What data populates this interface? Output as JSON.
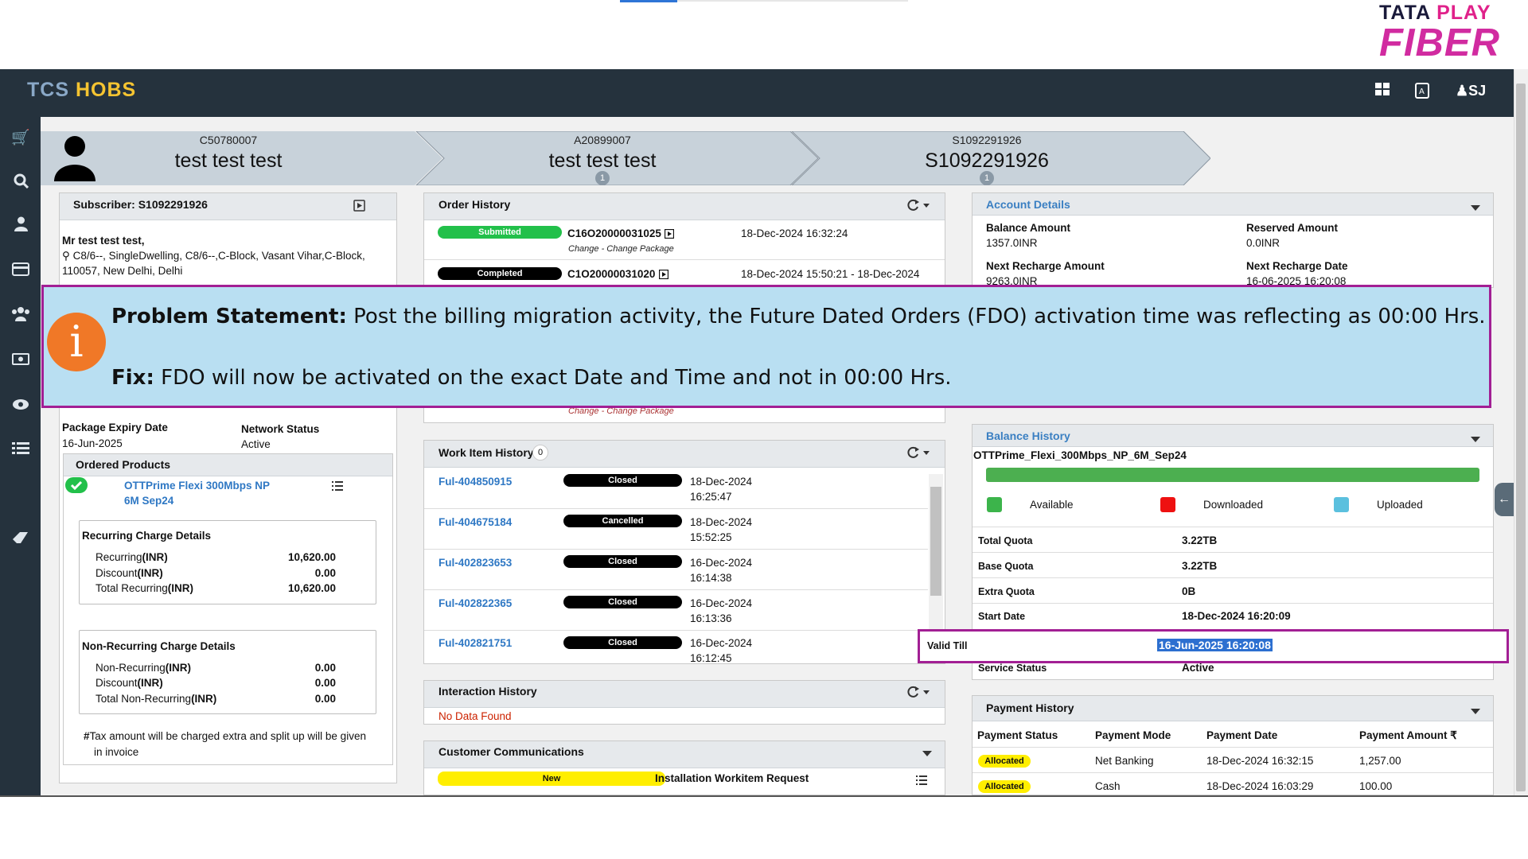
{
  "brand_logo": {
    "line1_a": "TATA",
    "line1_b": "PLAY",
    "line2": "FIBER"
  },
  "app": {
    "name_a": "TCS",
    "name_b": "HOBS",
    "user": "SJ"
  },
  "breadcrumb": [
    {
      "id": "C50780007",
      "name": "test test test",
      "badge": ""
    },
    {
      "id": "A20899007",
      "name": "test test test",
      "badge": "1"
    },
    {
      "id": "S1092291926",
      "name": "S1092291926",
      "badge": "1"
    }
  ],
  "subscriber": {
    "title": "Subscriber: S1092291926",
    "name": "Mr test test test",
    "address_line1": "C8/6--, SingleDwelling, C8/6--,C-Block, Vasant Vihar,C-Block,",
    "address_line2": "110057, New Delhi, Delhi",
    "package_expiry_label": "Package Expiry Date",
    "package_expiry_value": "16-Jun-2025",
    "network_status_label": "Network Status",
    "network_status_value": "Active",
    "ordered_products_label": "Ordered Products",
    "product_name_line1": "OTTPrime Flexi 300Mbps NP",
    "product_name_line2": "6M Sep24",
    "recurring": {
      "title": "Recurring Charge Details",
      "rows": [
        {
          "label": "Recurring",
          "unit": "(INR)",
          "value": "10,620.00"
        },
        {
          "label": "Discount",
          "unit": "(INR)",
          "value": "0.00"
        },
        {
          "label": "Total Recurring",
          "unit": "(INR)",
          "value": "10,620.00"
        }
      ]
    },
    "non_recurring": {
      "title": "Non-Recurring Charge Details",
      "rows": [
        {
          "label": "Non-Recurring",
          "unit": "(INR)",
          "value": "0.00"
        },
        {
          "label": "Discount",
          "unit": "(INR)",
          "value": "0.00"
        },
        {
          "label": "Total Non-Recurring",
          "unit": "(INR)",
          "value": "0.00"
        }
      ]
    },
    "tax_note_line1": "Tax amount will be charged extra and split up will be given",
    "tax_note_line2": "in invoice"
  },
  "order_history": {
    "title": "Order History",
    "orders": [
      {
        "status": "Submitted",
        "id": "C16O20000031025",
        "date": "18-Dec-2024 16:32:24",
        "type": "Change - Change Package"
      },
      {
        "status": "Completed",
        "id": "C1O20000031020",
        "date": "18-Dec-2024 15:50:21 - 18-Dec-2024",
        "type": ""
      }
    ],
    "partial_type": "Change - Change Package"
  },
  "work_items": {
    "title": "Work Item History",
    "count": "0",
    "rows": [
      {
        "id": "Ful-404850915",
        "status": "Closed",
        "date": "18-Dec-2024",
        "time": "16:25:47"
      },
      {
        "id": "Ful-404675184",
        "status": "Cancelled",
        "date": "18-Dec-2024",
        "time": "15:52:25"
      },
      {
        "id": "Ful-402823653",
        "status": "Closed",
        "date": "16-Dec-2024",
        "time": "16:14:38"
      },
      {
        "id": "Ful-402822365",
        "status": "Closed",
        "date": "16-Dec-2024",
        "time": "16:13:36"
      },
      {
        "id": "Ful-402821751",
        "status": "Closed",
        "date": "16-Dec-2024",
        "time": "16:12:45"
      }
    ]
  },
  "interaction_history": {
    "title": "Interaction History",
    "empty": "No Data Found"
  },
  "customer_comms": {
    "title": "Customer Communications",
    "status": "New",
    "text": "Installation Workitem Request"
  },
  "account_details": {
    "title": "Account Details",
    "balance_amount_label": "Balance Amount",
    "balance_amount_value": "1357.0INR",
    "reserved_amount_label": "Reserved Amount",
    "reserved_amount_value": "0.0INR",
    "next_recharge_amount_label": "Next Recharge Amount",
    "next_recharge_amount_value": "9263.0INR",
    "next_recharge_date_label": "Next Recharge Date",
    "next_recharge_date_value": "16-06-2025 16:20:08"
  },
  "balance_history": {
    "title": "Balance History",
    "plan": "OTTPrime_Flexi_300Mbps_NP_6M_Sep24",
    "available_fraction": 1.0,
    "legend": [
      {
        "label": "Available",
        "color": "#3cb44b"
      },
      {
        "label": "Downloaded",
        "color": "#ee1111"
      },
      {
        "label": "Uploaded",
        "color": "#5bc0de"
      }
    ],
    "rows": [
      {
        "label": "Total Quota",
        "value": "3.22TB"
      },
      {
        "label": "Base Quota",
        "value": "3.22TB"
      },
      {
        "label": "Extra Quota",
        "value": "0B"
      },
      {
        "label": "Start Date",
        "value": "18-Dec-2024 16:20:09"
      },
      {
        "label": "Valid Till",
        "value": "16-Jun-2025 16:20:08"
      },
      {
        "label": "Service Status",
        "value": "Active"
      }
    ]
  },
  "payment_history": {
    "title": "Payment History",
    "columns": [
      "Payment Status",
      "Payment Mode",
      "Payment Date",
      "Payment Amount ₹"
    ],
    "rows": [
      {
        "status": "Allocated",
        "mode": "Net Banking",
        "date": "18-Dec-2024 16:32:15",
        "amount": "1,257.00"
      },
      {
        "status": "Allocated",
        "mode": "Cash",
        "date": "18-Dec-2024 16:03:29",
        "amount": "100.00"
      }
    ]
  },
  "callout": {
    "problem_label": "Problem Statement:",
    "problem_text": " Post the billing migration activity, the Future Dated Orders (FDO) activation time was reflecting as 00:00 Hrs.",
    "fix_label": "Fix:",
    "fix_text": " FDO will now be activated on the exact Date and Time and not in 00:00 Hrs.",
    "icon": "info-icon"
  }
}
